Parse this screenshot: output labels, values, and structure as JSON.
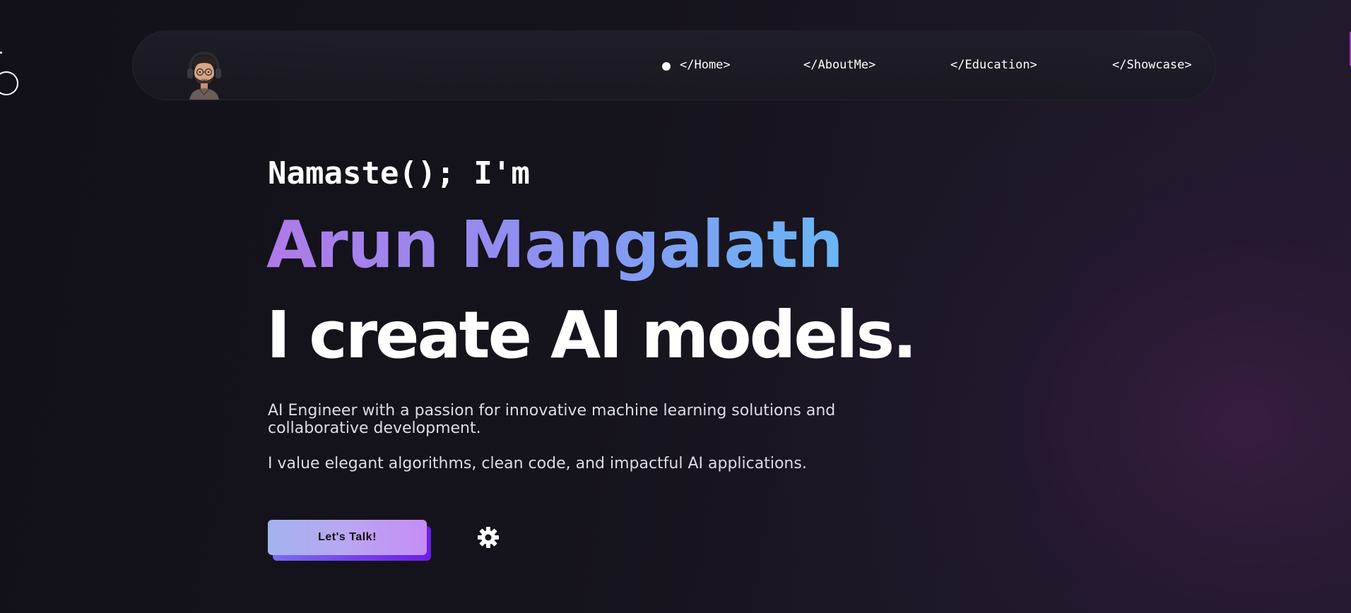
{
  "nav": {
    "avatar_icon": "avatar-icon",
    "active_indicator_icon": "dot-icon",
    "items": [
      {
        "label": "</Home>",
        "active": true
      },
      {
        "label": "</AboutMe>",
        "active": false
      },
      {
        "label": "</Education>",
        "active": false
      },
      {
        "label": "</Showcase>",
        "active": false
      }
    ]
  },
  "hero": {
    "greeting": "Namaste(); I'm",
    "name": "Arun Mangalath",
    "tagline": "I create AI models.",
    "description_1": "AI Engineer with a passion for innovative machine learning solutions and collaborative development.",
    "description_2": "I value elegant algorithms, clean code, and impactful AI applications.",
    "cta_label": "Let's Talk!",
    "settings_icon": "gear-icon"
  },
  "colors": {
    "background": "#13121a",
    "name_gradient_start": "#b07ae8",
    "name_gradient_end": "#6ab6f5",
    "cta_gradient_start": "#a3b3ee",
    "cta_gradient_end": "#c58df5",
    "cta_shadow": "#6d1de8"
  }
}
